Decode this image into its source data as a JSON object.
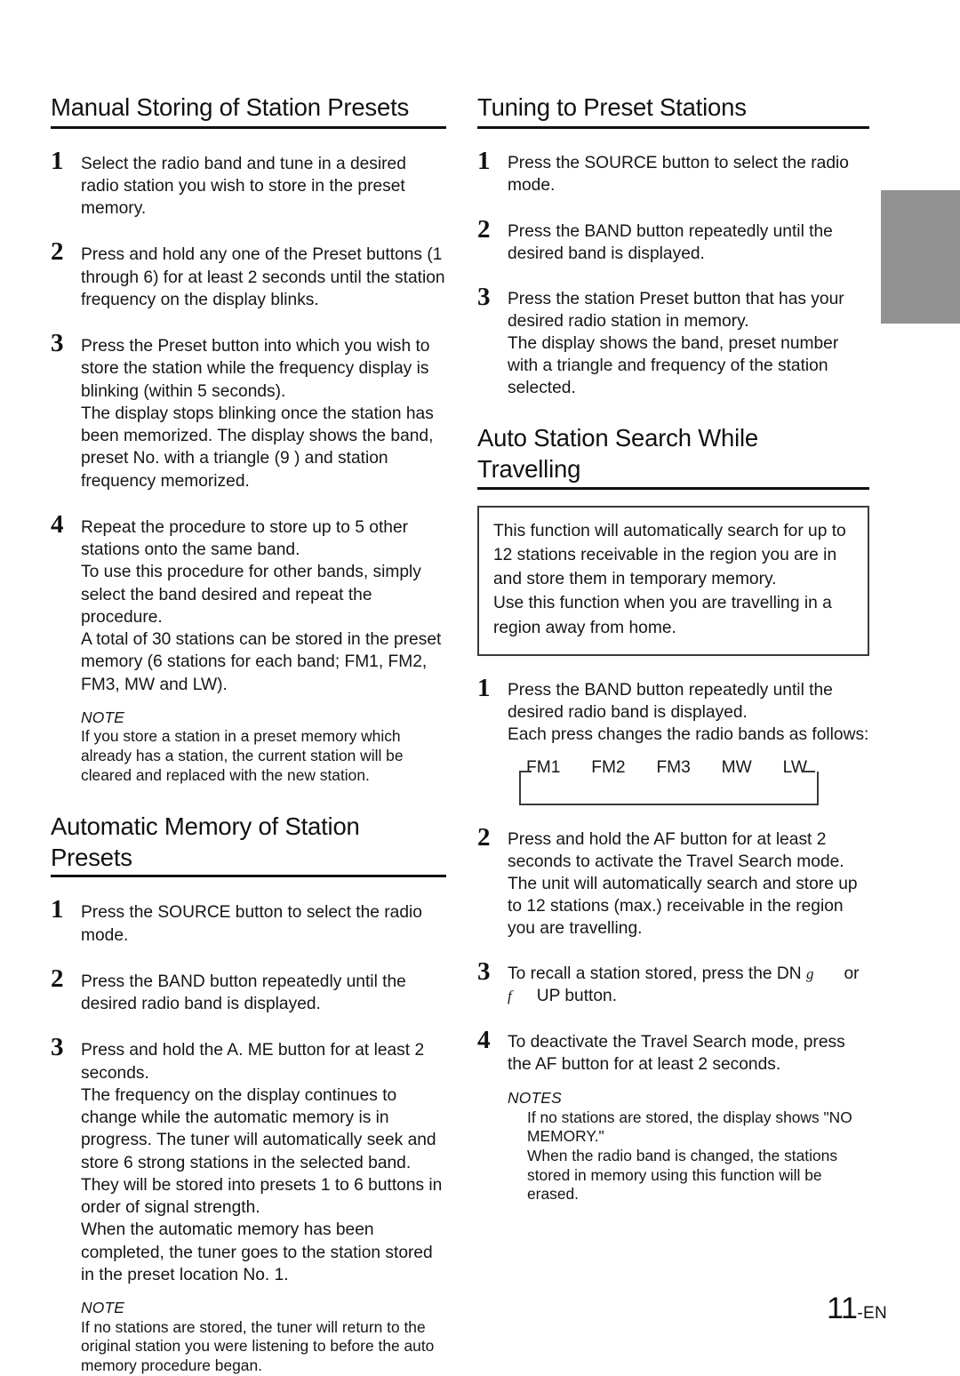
{
  "page": {
    "folio_number": "11",
    "folio_suffix": "-EN"
  },
  "left_column": {
    "section1": {
      "heading": "Manual Storing of Station Presets",
      "steps": [
        {
          "num": "1",
          "paragraphs": [
            "Select the radio band and tune in a desired radio station you wish to store in the preset memory."
          ]
        },
        {
          "num": "2",
          "paragraphs": [
            "Press and hold any one of the Preset buttons (1 through 6)  for at least 2 seconds until the station frequency on the display blinks."
          ]
        },
        {
          "num": "3",
          "paragraphs": [
            "Press the Preset  button into which you wish to store the station while the frequency display is blinking (within 5 seconds).",
            "The display stops blinking once the station has been memorized. The display shows the band, preset No. with a triangle (9 ) and station frequency memorized."
          ]
        },
        {
          "num": "4",
          "paragraphs": [
            "Repeat the procedure to store up to 5 other stations onto the same band.",
            "To use this procedure for other bands, simply select the band desired and repeat the procedure.",
            "A total of 30 stations can be stored in the preset memory (6 stations for each band; FM1, FM2, FM3, MW and LW)."
          ]
        }
      ],
      "note": {
        "title": "NOTE",
        "body": "If you store a station in a preset memory which already has a station, the current station will be cleared and replaced with the new station."
      }
    },
    "section2": {
      "heading": "Automatic Memory of Station Presets",
      "steps": [
        {
          "num": "1",
          "paragraphs": [
            "Press the SOURCE button to select the radio mode."
          ]
        },
        {
          "num": "2",
          "paragraphs": [
            "Press the BAND button repeatedly until the desired radio band is displayed."
          ]
        },
        {
          "num": "3",
          "paragraphs": [
            "Press and hold the A. ME button for at least 2 seconds.",
            "The frequency on the display continues to change while the automatic memory is in progress. The tuner will automatically seek and store 6 strong stations in the selected band.",
            "They will be stored into presets 1 to 6 buttons in order of signal strength.",
            "When the automatic memory has been completed, the tuner goes to the station stored in the preset location No. 1."
          ]
        }
      ],
      "note": {
        "title": "NOTE",
        "body": "If no stations are stored, the tuner will return to the original station you were listening to before the auto memory procedure began."
      }
    }
  },
  "right_column": {
    "section1": {
      "heading": "Tuning to Preset Stations",
      "steps": [
        {
          "num": "1",
          "paragraphs": [
            "Press the SOURCE button to select the radio mode."
          ]
        },
        {
          "num": "2",
          "paragraphs": [
            "Press the BAND button repeatedly until the desired band is displayed."
          ]
        },
        {
          "num": "3",
          "paragraphs": [
            "Press the station Preset button that has your desired radio station in memory.",
            "The display shows the band, preset number with a triangle and frequency of the station selected."
          ]
        }
      ]
    },
    "section2": {
      "heading_line1": "Auto Station Search While",
      "heading_line2": "Travelling",
      "callout": [
        "This function will automatically search for up to 12 stations receivable in the region you are in and store them in temporary memory.",
        "Use this function when you are travelling in a region away from home."
      ],
      "step1": {
        "num": "1",
        "paragraphs": [
          "Press the BAND button repeatedly until the desired radio band is displayed.",
          "Each press changes the radio bands as follows:"
        ]
      },
      "band_sequence": [
        "FM1",
        "FM2",
        "FM3",
        "MW",
        "LW"
      ],
      "step2": {
        "num": "2",
        "paragraphs": [
          "Press and hold the AF button for at least 2 seconds to activate the Travel Search mode. The unit will automatically search and store up to 12 stations (max.) receivable in the region you are travelling."
        ]
      },
      "step3": {
        "num": "3",
        "line1_before": "To recall a station stored, press the DN ",
        "line1_symbol": "g",
        "line1_after": "or",
        "line2_symbol": "f",
        "line2_after": "UP button."
      },
      "step4": {
        "num": "4",
        "paragraphs": [
          "To deactivate the Travel Search mode, press the AF button for at least 2 seconds."
        ]
      },
      "notes": {
        "title": "NOTES",
        "items": [
          "If no stations are stored, the display shows \"NO MEMORY.\"",
          "When the radio band is changed, the stations stored in memory using this function will be erased."
        ]
      }
    }
  }
}
